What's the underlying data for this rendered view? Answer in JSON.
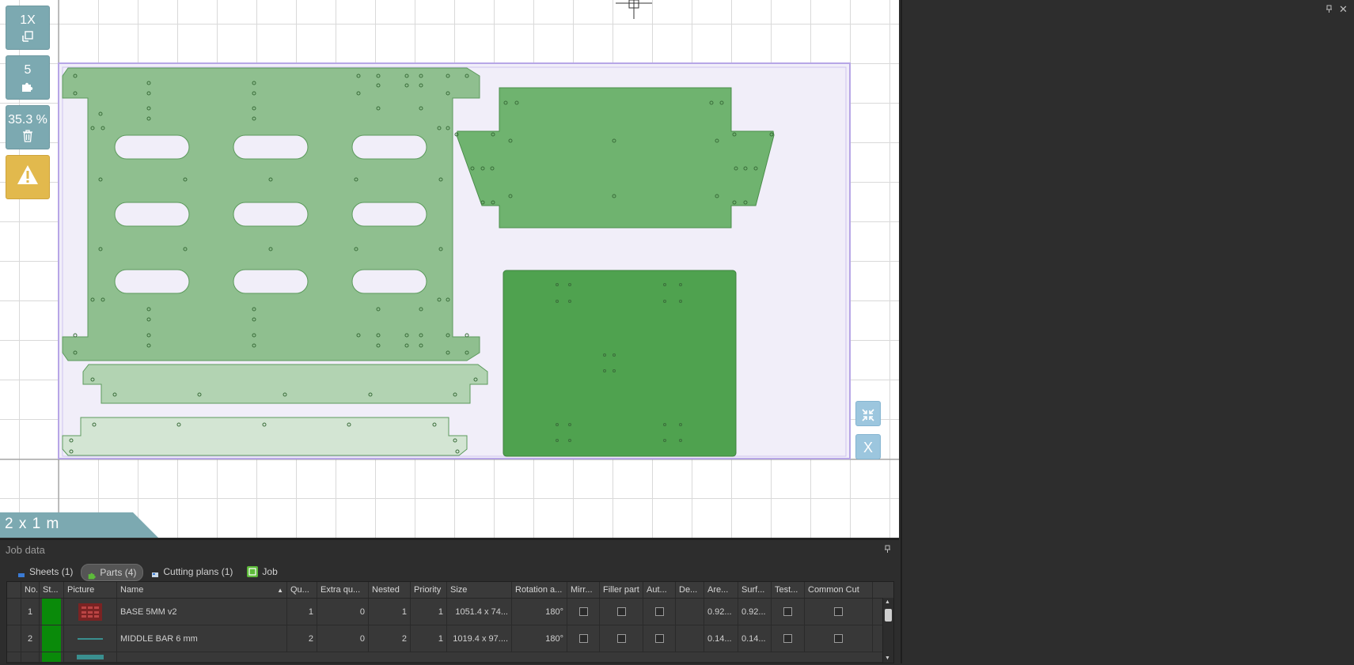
{
  "canvas": {
    "tools": {
      "scale_value": "1X",
      "parts_count": "5",
      "utilization": "35.3 %"
    },
    "sheet_size_label": "2 x 1 m",
    "zoom_fit_icon": "collapse-arrows-icon",
    "close_view_label": "X"
  },
  "job_data": {
    "title": "Job data",
    "tabs": [
      {
        "label": "Sheets (1)",
        "icon": "sheet-icon"
      },
      {
        "label": "Parts (4)",
        "icon": "puzzle-icon"
      },
      {
        "label": "Cutting plans (1)",
        "icon": "cutting-plan-icon"
      },
      {
        "label": "Job",
        "icon": "job-icon"
      }
    ],
    "table": {
      "headers": [
        "No.",
        "St...",
        "Picture",
        "Name",
        "Qu...",
        "Extra qu...",
        "Nested",
        "Priority",
        "Size",
        "Rotation a...",
        "Mirr...",
        "Filler part",
        "Aut...",
        "De...",
        "Are...",
        "Surf...",
        "Test...",
        "Common Cut"
      ],
      "rows": [
        {
          "no": "1",
          "name": "BASE 5MM v2",
          "qty": "1",
          "extra": "0",
          "nested": "1",
          "priority": "1",
          "size": "1051.4 x 74...",
          "rotation": "180°",
          "area": "0.92...",
          "surface": "0.92..."
        },
        {
          "no": "2",
          "name": "MIDDLE BAR 6 mm",
          "qty": "2",
          "extra": "0",
          "nested": "2",
          "priority": "1",
          "size": "1019.4 x 97....",
          "rotation": "180°",
          "area": "0.14...",
          "surface": "0.14..."
        }
      ]
    }
  },
  "colors": {
    "status_ok": "#0a8a0a",
    "tool_bg": "#7ca9b1",
    "warning": "#e2b94d",
    "sheet_fill": "#f1eef9",
    "sheet_border": "#b7a6e6"
  }
}
